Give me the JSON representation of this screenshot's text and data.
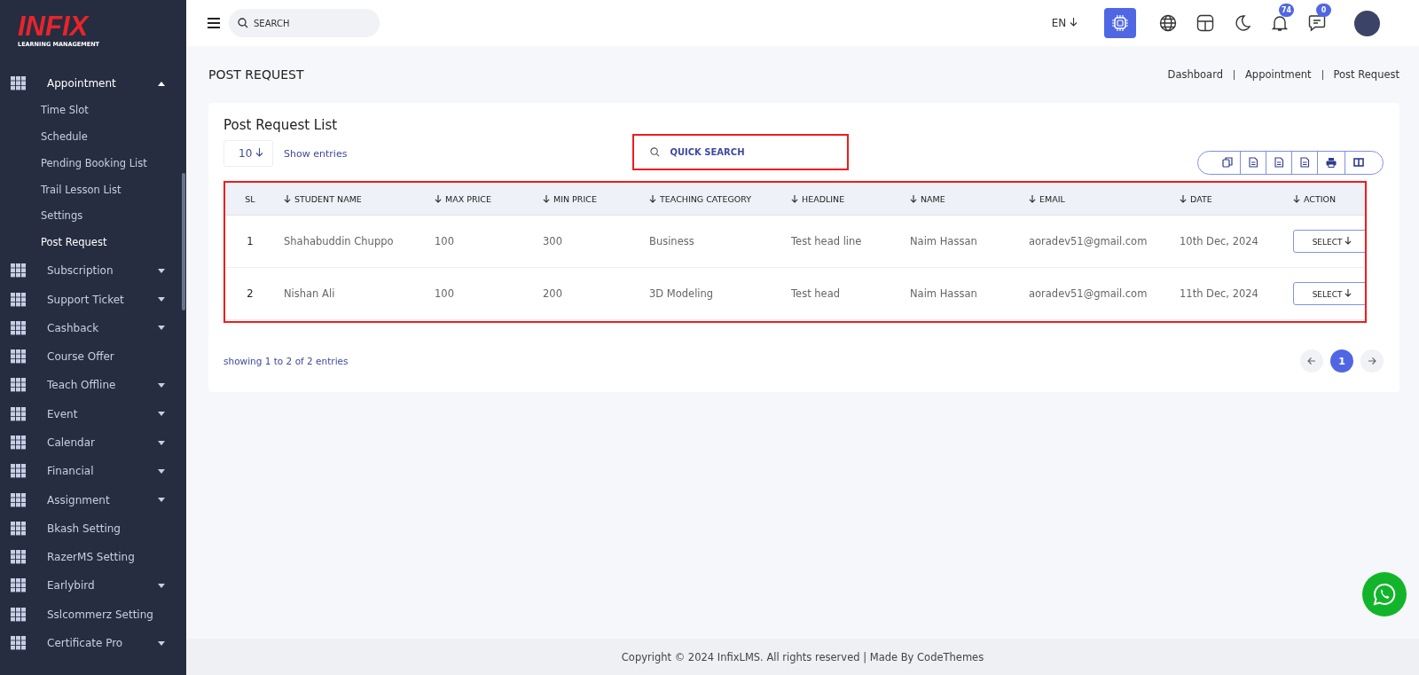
{
  "logo": {
    "name": "INFIX",
    "tagline": "LEARNING MANAGEMENT"
  },
  "sidebar": {
    "items": [
      {
        "label": "Appointment",
        "kind": "group",
        "expanded": true,
        "children": [
          {
            "label": "Time Slot",
            "selected": false
          },
          {
            "label": "Schedule",
            "selected": false
          },
          {
            "label": "Pending Booking List",
            "selected": false
          },
          {
            "label": "Trail Lesson List",
            "selected": false
          },
          {
            "label": "Settings",
            "selected": false
          },
          {
            "label": "Post Request",
            "selected": true
          }
        ]
      },
      {
        "label": "Subscription",
        "kind": "group",
        "expanded": false
      },
      {
        "label": "Support Ticket",
        "kind": "group",
        "expanded": false
      },
      {
        "label": "Cashback",
        "kind": "group",
        "expanded": false
      },
      {
        "label": "Course Offer",
        "kind": "link"
      },
      {
        "label": "Teach Offline",
        "kind": "group",
        "expanded": false
      },
      {
        "label": "Event",
        "kind": "group",
        "expanded": false
      },
      {
        "label": "Calendar",
        "kind": "group",
        "expanded": false
      },
      {
        "label": "Financial",
        "kind": "group",
        "expanded": false
      },
      {
        "label": "Assignment",
        "kind": "group",
        "expanded": false
      },
      {
        "label": "Bkash Setting",
        "kind": "link"
      },
      {
        "label": "RazerMS Setting",
        "kind": "link"
      },
      {
        "label": "Earlybird",
        "kind": "group",
        "expanded": false
      },
      {
        "label": "Sslcommerz Setting",
        "kind": "link"
      },
      {
        "label": "Certificate Pro",
        "kind": "group",
        "expanded": false
      }
    ]
  },
  "topbar": {
    "search": {
      "placeholder": "SEARCH"
    },
    "language": "EN",
    "notifications": "74",
    "messages": "0"
  },
  "page": {
    "title": "POST REQUEST",
    "breadcrumbs": [
      "Dashboard",
      "Appointment",
      "Post Request"
    ]
  },
  "card": {
    "title": "Post Request List",
    "page_size": "10",
    "show_entries": "Show entries",
    "quick_search": {
      "placeholder": "QUICK SEARCH"
    },
    "table": {
      "columns": [
        "SL",
        "STUDENT NAME",
        "MAX PRICE",
        "MIN PRICE",
        "TEACHING CATEGORY",
        "HEADLINE",
        "NAME",
        "EMAIL",
        "DATE",
        "ACTION"
      ],
      "rows": [
        {
          "sl": "1",
          "student_name": "Shahabuddin Chuppo",
          "max_price": "100",
          "min_price": "300",
          "teaching_category": "Business",
          "headline": "Test head line",
          "name": "Naim Hassan",
          "email": "aoradev51@gmail.com",
          "date": "10th Dec, 2024",
          "action": "SELECT"
        },
        {
          "sl": "2",
          "student_name": "Nishan Ali",
          "max_price": "100",
          "min_price": "200",
          "teaching_category": "3D Modeling",
          "headline": "Test head",
          "name": "Naim Hassan",
          "email": "aoradev51@gmail.com",
          "date": "11th Dec, 2024",
          "action": "SELECT"
        }
      ]
    },
    "summary": "showing 1 to 2 of 2 entries",
    "pagination": [
      {
        "label": "1",
        "selected": true
      }
    ]
  },
  "footer": "Copyright © 2024 InfixLMS. All rights reserved | Made By CodeThemes"
}
